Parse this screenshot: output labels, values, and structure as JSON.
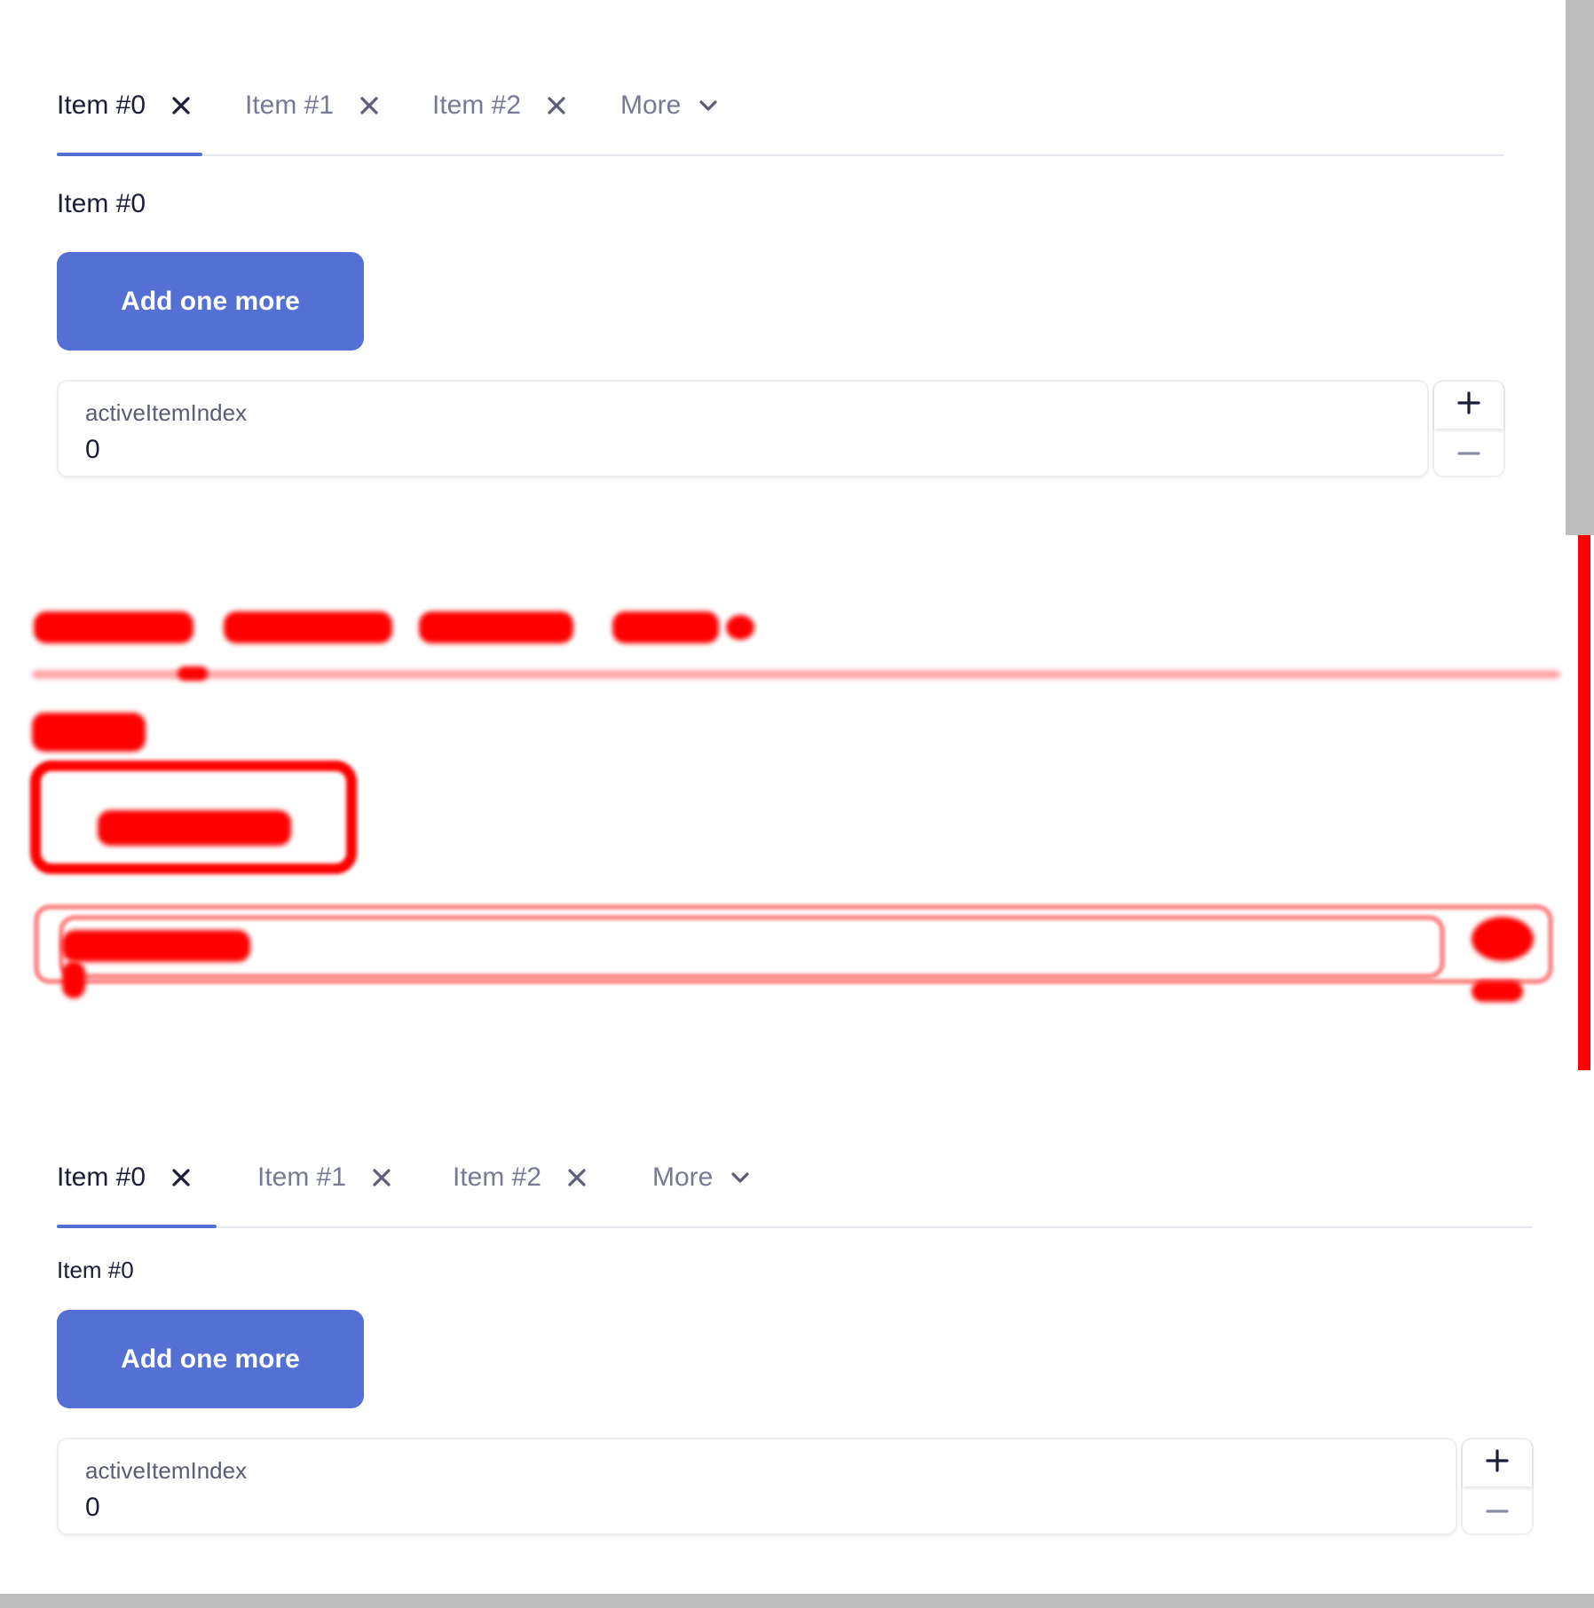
{
  "top_panel": {
    "tabs": [
      {
        "label": "Item #0",
        "active": true
      },
      {
        "label": "Item #1",
        "active": false
      },
      {
        "label": "Item #2",
        "active": false
      }
    ],
    "more_label": "More",
    "content_label": "Item #0",
    "add_button_label": "Add one more",
    "numfield": {
      "label": "activeItemIndex",
      "value": "0"
    }
  },
  "bottom_panel": {
    "tabs": [
      {
        "label": "Item #0",
        "active": true
      },
      {
        "label": "Item #1",
        "active": false
      },
      {
        "label": "Item #2",
        "active": false
      }
    ],
    "more_label": "More",
    "content_label": "Item #0",
    "add_button_label": "Add one more",
    "numfield": {
      "label": "activeItemIndex",
      "value": "0"
    }
  },
  "icons": {
    "tab_close": "close-icon",
    "more": "chevron-down-icon",
    "increment": "plus-icon",
    "decrement": "minus-icon"
  },
  "colors": {
    "accent": "#5470d4",
    "text": "#1b1d3a",
    "muted": "#767a95",
    "diff": "#ff0000",
    "scrollbar": "#bdbdbd"
  }
}
